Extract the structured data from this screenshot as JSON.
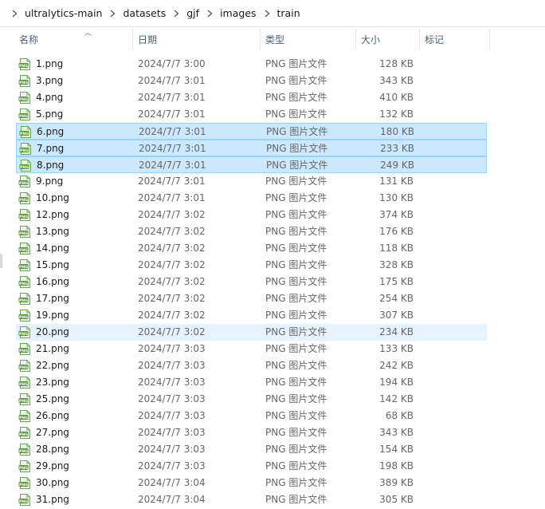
{
  "breadcrumb": {
    "items": [
      "ultralytics-main",
      "datasets",
      "gjf",
      "images",
      "train"
    ]
  },
  "columns": {
    "name": "名称",
    "date": "日期",
    "type": "类型",
    "size": "大小",
    "tag": "标记"
  },
  "colors": {
    "selected_bg": "#cce8ff",
    "selected_border": "#99d1ff",
    "hover_bg": "#e5f3ff",
    "icon_green": "#5a9e3a"
  },
  "files": [
    {
      "name": "1.png",
      "date": "2024/7/7 3:00",
      "type": "PNG 图片文件",
      "size": "128 KB",
      "state": ""
    },
    {
      "name": "3.png",
      "date": "2024/7/7 3:01",
      "type": "PNG 图片文件",
      "size": "343 KB",
      "state": ""
    },
    {
      "name": "4.png",
      "date": "2024/7/7 3:01",
      "type": "PNG 图片文件",
      "size": "410 KB",
      "state": ""
    },
    {
      "name": "5.png",
      "date": "2024/7/7 3:01",
      "type": "PNG 图片文件",
      "size": "132 KB",
      "state": ""
    },
    {
      "name": "6.png",
      "date": "2024/7/7 3:01",
      "type": "PNG 图片文件",
      "size": "180 KB",
      "state": "selected"
    },
    {
      "name": "7.png",
      "date": "2024/7/7 3:01",
      "type": "PNG 图片文件",
      "size": "233 KB",
      "state": "selected"
    },
    {
      "name": "8.png",
      "date": "2024/7/7 3:01",
      "type": "PNG 图片文件",
      "size": "249 KB",
      "state": "selected"
    },
    {
      "name": "9.png",
      "date": "2024/7/7 3:01",
      "type": "PNG 图片文件",
      "size": "131 KB",
      "state": ""
    },
    {
      "name": "10.png",
      "date": "2024/7/7 3:01",
      "type": "PNG 图片文件",
      "size": "130 KB",
      "state": ""
    },
    {
      "name": "12.png",
      "date": "2024/7/7 3:02",
      "type": "PNG 图片文件",
      "size": "374 KB",
      "state": ""
    },
    {
      "name": "13.png",
      "date": "2024/7/7 3:02",
      "type": "PNG 图片文件",
      "size": "176 KB",
      "state": ""
    },
    {
      "name": "14.png",
      "date": "2024/7/7 3:02",
      "type": "PNG 图片文件",
      "size": "118 KB",
      "state": ""
    },
    {
      "name": "15.png",
      "date": "2024/7/7 3:02",
      "type": "PNG 图片文件",
      "size": "328 KB",
      "state": ""
    },
    {
      "name": "16.png",
      "date": "2024/7/7 3:02",
      "type": "PNG 图片文件",
      "size": "175 KB",
      "state": ""
    },
    {
      "name": "17.png",
      "date": "2024/7/7 3:02",
      "type": "PNG 图片文件",
      "size": "254 KB",
      "state": ""
    },
    {
      "name": "19.png",
      "date": "2024/7/7 3:02",
      "type": "PNG 图片文件",
      "size": "307 KB",
      "state": ""
    },
    {
      "name": "20.png",
      "date": "2024/7/7 3:02",
      "type": "PNG 图片文件",
      "size": "234 KB",
      "state": "hover"
    },
    {
      "name": "21.png",
      "date": "2024/7/7 3:03",
      "type": "PNG 图片文件",
      "size": "133 KB",
      "state": ""
    },
    {
      "name": "22.png",
      "date": "2024/7/7 3:03",
      "type": "PNG 图片文件",
      "size": "242 KB",
      "state": ""
    },
    {
      "name": "23.png",
      "date": "2024/7/7 3:03",
      "type": "PNG 图片文件",
      "size": "194 KB",
      "state": ""
    },
    {
      "name": "25.png",
      "date": "2024/7/7 3:03",
      "type": "PNG 图片文件",
      "size": "142 KB",
      "state": ""
    },
    {
      "name": "26.png",
      "date": "2024/7/7 3:03",
      "type": "PNG 图片文件",
      "size": "68 KB",
      "state": ""
    },
    {
      "name": "27.png",
      "date": "2024/7/7 3:03",
      "type": "PNG 图片文件",
      "size": "343 KB",
      "state": ""
    },
    {
      "name": "28.png",
      "date": "2024/7/7 3:03",
      "type": "PNG 图片文件",
      "size": "154 KB",
      "state": ""
    },
    {
      "name": "29.png",
      "date": "2024/7/7 3:03",
      "type": "PNG 图片文件",
      "size": "198 KB",
      "state": ""
    },
    {
      "name": "30.png",
      "date": "2024/7/7 3:04",
      "type": "PNG 图片文件",
      "size": "389 KB",
      "state": ""
    },
    {
      "name": "31.png",
      "date": "2024/7/7 3:04",
      "type": "PNG 图片文件",
      "size": "305 KB",
      "state": ""
    }
  ]
}
